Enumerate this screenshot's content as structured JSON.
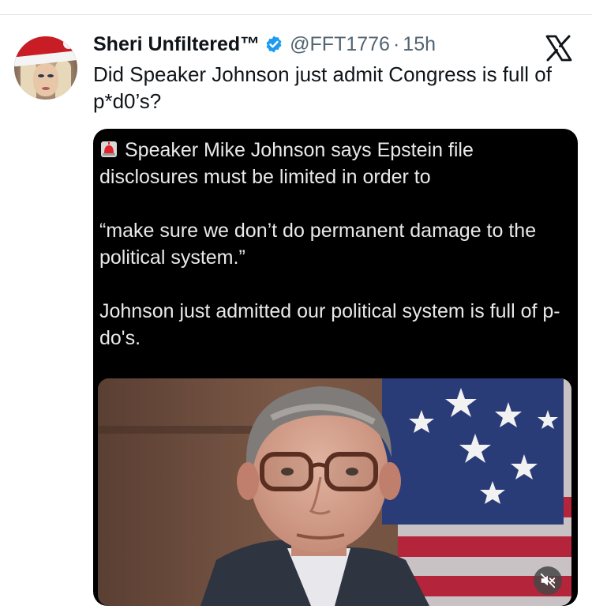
{
  "tweet": {
    "display_name": "Sheri Unfiltered™",
    "handle": "@FFT1776",
    "separator": "·",
    "time": "15h",
    "text": "Did Speaker Johnson just admit Congress is full of p*d0’s?"
  },
  "icons": {
    "verified": "verified-badge-icon",
    "platform": "x-logo-icon",
    "siren": "siren-icon",
    "mute": "speaker-muted-icon"
  },
  "colors": {
    "verified_blue": "#1d9bf0",
    "handle_gray": "#536471",
    "text_dark": "#0f1419"
  },
  "media": {
    "paragraph1": "Speaker Mike Johnson says Epstein file disclosures must be limited in order to",
    "paragraph2": "“make sure we don’t do permanent damage to the political system.”",
    "paragraph3": "Johnson just admitted our political system is full of p-do's."
  }
}
